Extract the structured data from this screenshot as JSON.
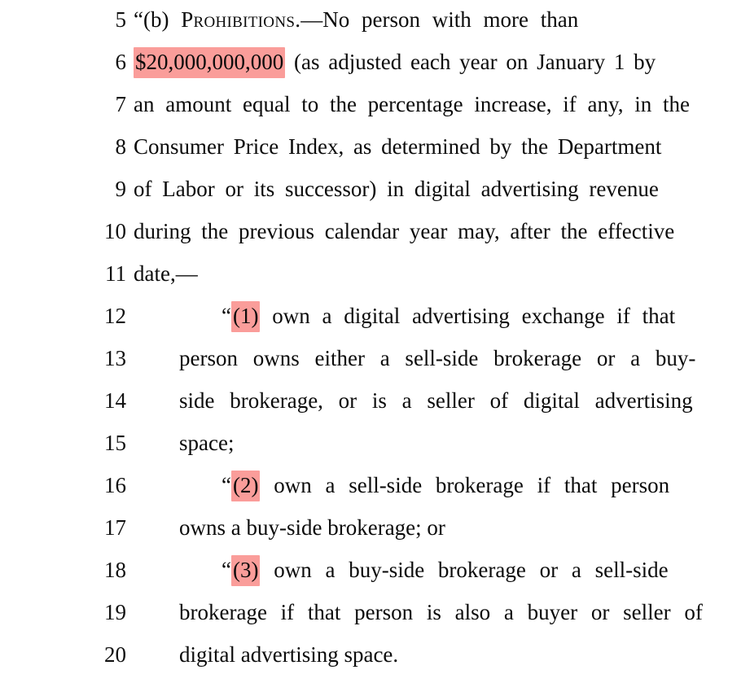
{
  "document": {
    "type": "legislative-bill-text",
    "background_color": "#ffffff",
    "text_color": "#0b0b0b",
    "highlight_color": "#fa9d9a"
  },
  "lines": [
    {
      "number": "5",
      "indent": "base",
      "justify": "j8",
      "segments": [
        {
          "text": "“(b) ",
          "highlight": false
        },
        {
          "text": "Prohibitions.",
          "highlight": false,
          "style": "smallcaps"
        },
        {
          "text": "—No person with more than",
          "highlight": false
        }
      ],
      "plain": "“(b) Prohibitions.—No person with more than"
    },
    {
      "number": "6",
      "indent": "base",
      "justify": "j4",
      "segments": [
        {
          "text": "$20,000,000,000",
          "highlight": true
        },
        {
          "text": " (as adjusted each year on January 1 by",
          "highlight": false
        }
      ],
      "plain": "$20,000,000,000 (as adjusted each year on January 1 by"
    },
    {
      "number": "7",
      "indent": "base",
      "justify": "j7",
      "segments": [
        {
          "text": "an amount equal to the percentage increase, if any, in the",
          "highlight": false
        }
      ],
      "plain": "an amount equal to the percentage increase, if any, in the"
    },
    {
      "number": "8",
      "indent": "base",
      "justify": "j5",
      "segments": [
        {
          "text": "Consumer Price Index, as determined by the Department",
          "highlight": false
        }
      ],
      "plain": "Consumer Price Index, as determined by the Department"
    },
    {
      "number": "9",
      "indent": "base",
      "justify": "j6",
      "segments": [
        {
          "text": "of Labor or its successor) in digital advertising revenue",
          "highlight": false
        }
      ],
      "plain": "of Labor or its successor) in digital advertising revenue"
    },
    {
      "number": "10",
      "indent": "base",
      "justify": "j6",
      "segments": [
        {
          "text": "during the previous calendar year may, after the effective",
          "highlight": false
        }
      ],
      "plain": "during the previous calendar year may, after the effective"
    },
    {
      "number": "11",
      "indent": "base",
      "justify": "j0",
      "segments": [
        {
          "text": "date,—",
          "highlight": false
        }
      ],
      "plain": "date,—"
    },
    {
      "number": "12",
      "indent": "first",
      "justify": "j8",
      "segments": [
        {
          "text": "“",
          "highlight": false
        },
        {
          "text": "(1)",
          "highlight": true
        },
        {
          "text": " own a digital advertising exchange if that",
          "highlight": false
        }
      ],
      "plain": "“(1) own a digital advertising exchange if that"
    },
    {
      "number": "13",
      "indent": "hang",
      "justify": "j12",
      "segments": [
        {
          "text": "person owns either a sell-side brokerage or a buy-",
          "highlight": false
        }
      ],
      "plain": "person owns either a sell-side brokerage or a buy-"
    },
    {
      "number": "14",
      "indent": "hang",
      "justify": "j12",
      "segments": [
        {
          "text": "side brokerage, or is a seller of digital advertising",
          "highlight": false
        }
      ],
      "plain": "side brokerage, or is a seller of digital advertising"
    },
    {
      "number": "15",
      "indent": "hang",
      "justify": "j0",
      "segments": [
        {
          "text": "space;",
          "highlight": false
        }
      ],
      "plain": "space;"
    },
    {
      "number": "16",
      "indent": "first",
      "justify": "j10",
      "segments": [
        {
          "text": "“",
          "highlight": false
        },
        {
          "text": "(2)",
          "highlight": true
        },
        {
          "text": " own a sell-side brokerage if that person",
          "highlight": false
        }
      ],
      "plain": "“(2) own a sell-side brokerage if that person"
    },
    {
      "number": "17",
      "indent": "hang",
      "justify": "j0",
      "segments": [
        {
          "text": "owns a buy-side brokerage; or",
          "highlight": false
        }
      ],
      "plain": "owns a buy-side brokerage; or"
    },
    {
      "number": "18",
      "indent": "first",
      "justify": "j10",
      "segments": [
        {
          "text": "“",
          "highlight": false
        },
        {
          "text": "(3)",
          "highlight": true
        },
        {
          "text": " own a buy-side brokerage or a sell-side",
          "highlight": false
        }
      ],
      "plain": "“(3) own a buy-side brokerage or a sell-side"
    },
    {
      "number": "19",
      "indent": "hang",
      "justify": "j10",
      "segments": [
        {
          "text": "brokerage if that person is also a buyer or seller of",
          "highlight": false
        }
      ],
      "plain": "brokerage if that person is also a buyer or seller of"
    },
    {
      "number": "20",
      "indent": "hang",
      "justify": "j0",
      "segments": [
        {
          "text": "digital advertising space.",
          "highlight": false
        }
      ],
      "plain": "digital advertising space."
    }
  ]
}
